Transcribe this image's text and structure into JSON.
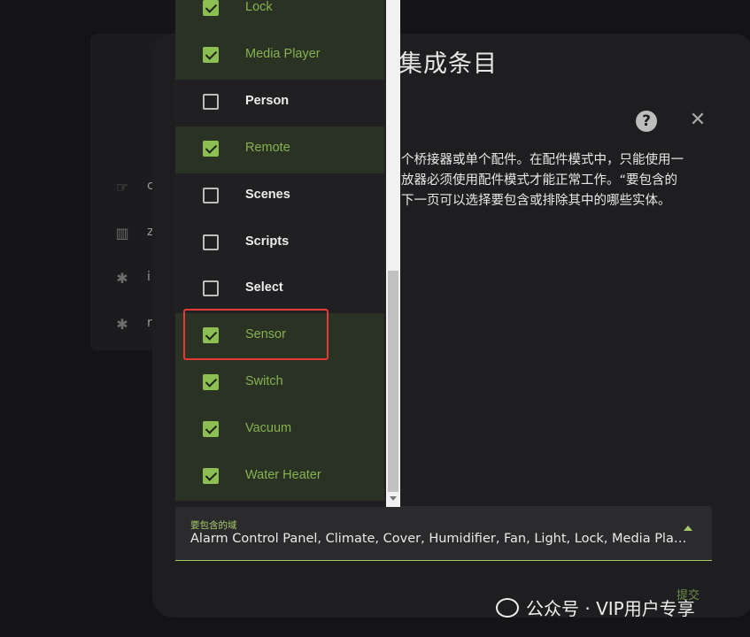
{
  "dialog": {
    "title": "集成条目",
    "description_lines": [
      "个桥接器或单个配件。在配件模式中，只能使用一",
      "放器必须使用配件模式才能正常工作。“要包含的",
      "下一页可以选择要包含或排除其中的哪些实体。"
    ],
    "help_icon": "help-circle-icon",
    "close_icon": "close-icon"
  },
  "domains_field": {
    "label": "要包含的域",
    "value": "Alarm Control Panel, Climate, Cover, Humidifier, Fan, Light, Lock, Media Player, Remote, Sensor, Switch, Vacuum, Water Heater"
  },
  "submit_label": "提交",
  "dropdown": {
    "items": [
      {
        "label": "Lock",
        "checked": true
      },
      {
        "label": "Media Player",
        "checked": true
      },
      {
        "label": "Person",
        "checked": false
      },
      {
        "label": "Remote",
        "checked": true
      },
      {
        "label": "Scenes",
        "checked": false
      },
      {
        "label": "Scripts",
        "checked": false
      },
      {
        "label": "Select",
        "checked": false
      },
      {
        "label": "Sensor",
        "checked": true
      },
      {
        "label": "Switch",
        "checked": true
      },
      {
        "label": "Vacuum",
        "checked": true
      },
      {
        "label": "Water Heater",
        "checked": true
      }
    ]
  },
  "background": {
    "letters": [
      "c",
      "z",
      "i",
      "r"
    ],
    "icons": [
      "hand-icon",
      "library-icon",
      "bug-icon",
      "bug-icon"
    ]
  },
  "watermark": {
    "text": "公众号 · VIP用户专享"
  },
  "colors": {
    "accent": "#8cbe53",
    "highlight": "#e53a35"
  }
}
